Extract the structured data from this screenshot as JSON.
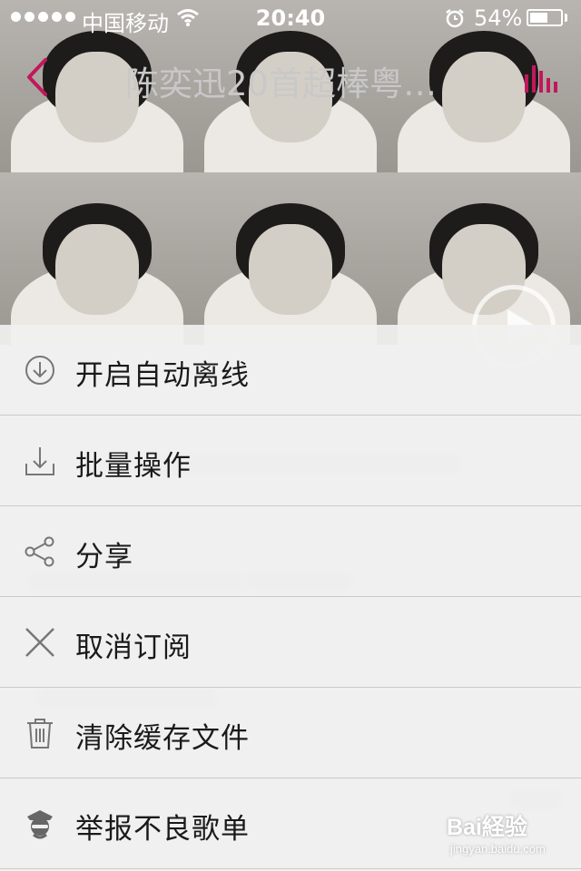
{
  "status_bar": {
    "carrier": "中国移动",
    "time": "20:40",
    "battery_percent": "54%",
    "signal_icon": "signal-dots-icon",
    "wifi_icon": "wifi-icon",
    "alarm_icon": "alarm-clock-icon",
    "battery_icon": "battery-icon"
  },
  "nav": {
    "title": "陈奕迅20首超棒粤…",
    "back_icon": "chevron-left-icon",
    "now_playing_icon": "equalizer-bars-icon",
    "accent_color": "#c2185b"
  },
  "menu": {
    "items": [
      {
        "label": "开启自动离线",
        "icon": "download-circle-icon"
      },
      {
        "label": "批量操作",
        "icon": "tray-download-icon"
      },
      {
        "label": "分享",
        "icon": "share-icon"
      },
      {
        "label": "取消订阅",
        "icon": "close-x-icon"
      },
      {
        "label": "清除缓存文件",
        "icon": "trash-icon"
      },
      {
        "label": "举报不良歌单",
        "icon": "police-officer-icon"
      }
    ]
  },
  "watermark": {
    "brand": "Bai経验",
    "url": "jingyan.baidu.com"
  }
}
